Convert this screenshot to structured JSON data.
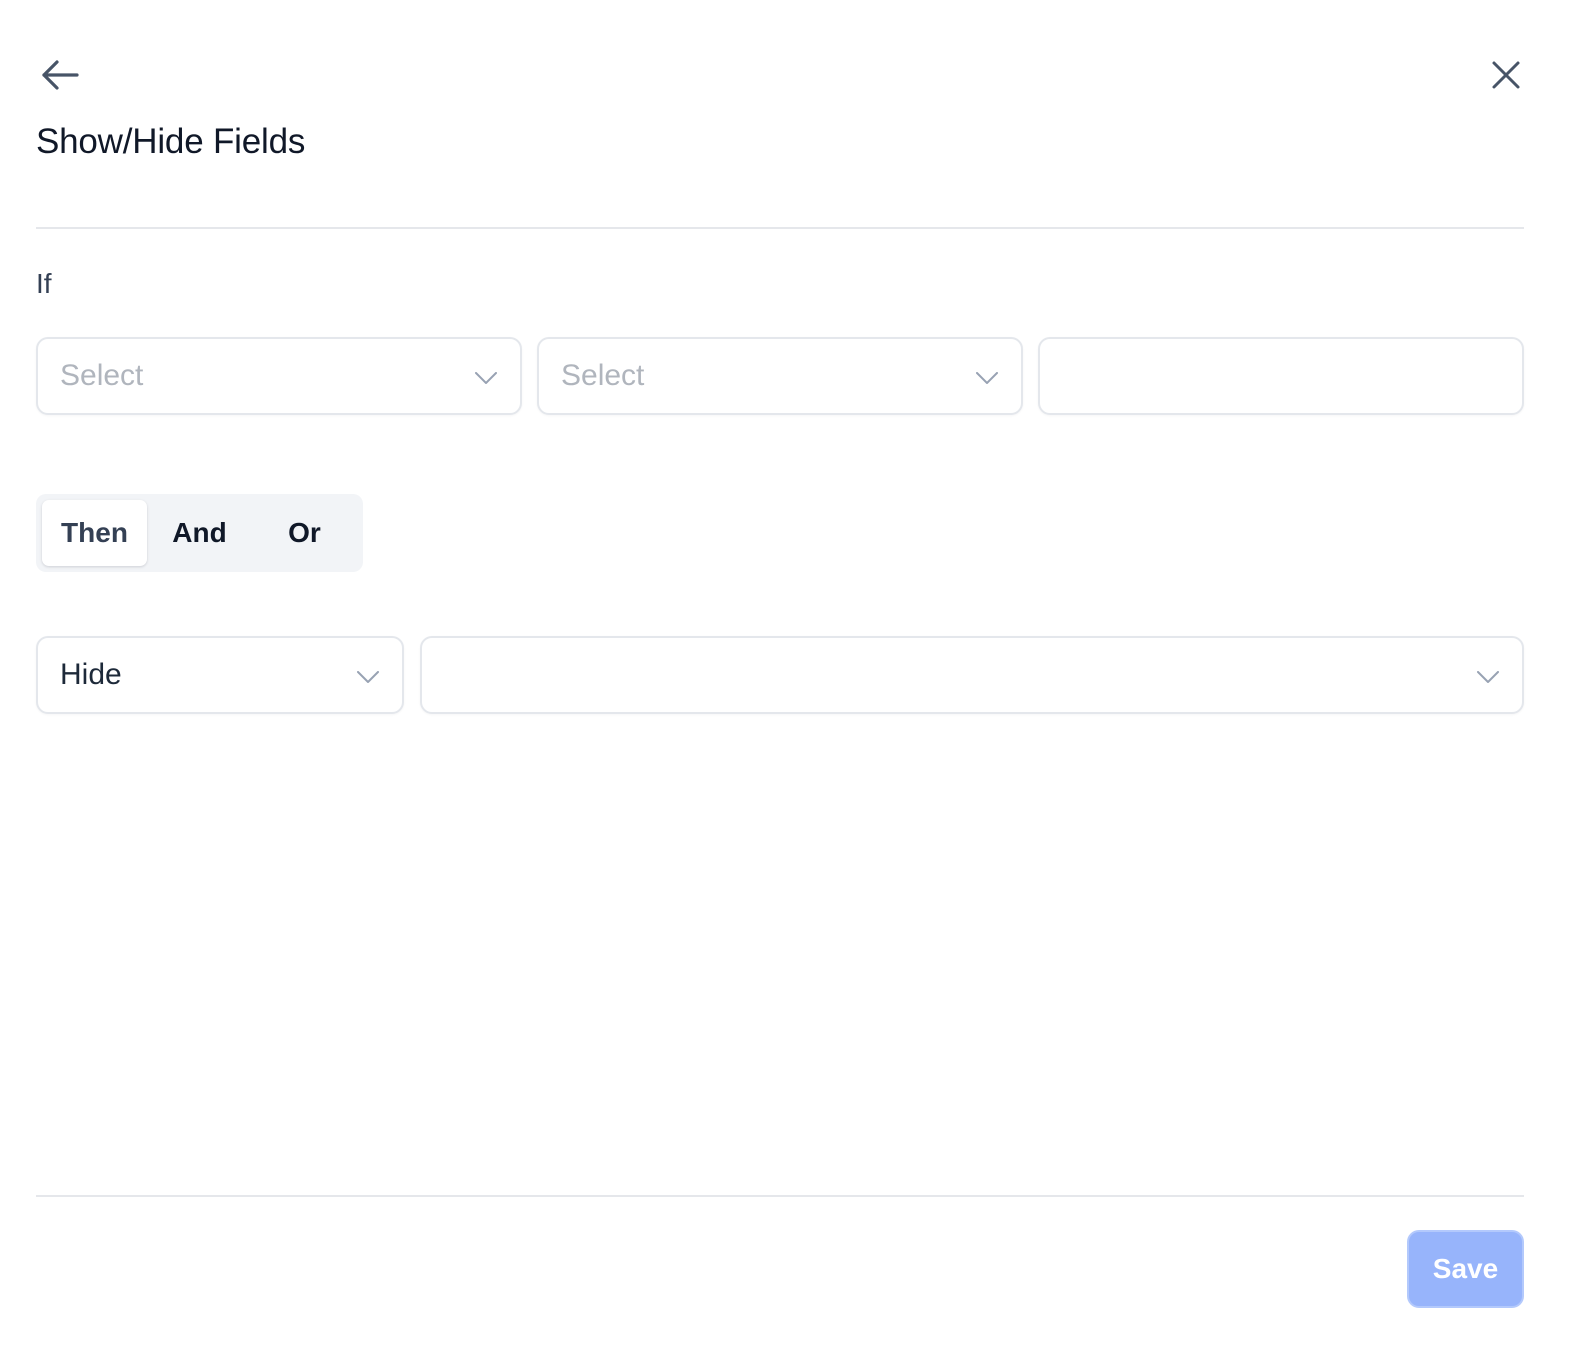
{
  "header": {
    "back_icon": "arrow-left-icon",
    "close_icon": "close-icon",
    "title": "Show/Hide Fields"
  },
  "condition": {
    "label": "If",
    "field_select": {
      "value": "",
      "placeholder": "Select"
    },
    "operator_select": {
      "value": "",
      "placeholder": "Select"
    },
    "value_input": {
      "value": "",
      "placeholder": ""
    }
  },
  "logic_tabs": [
    {
      "label": "Then",
      "active": true
    },
    {
      "label": "And",
      "active": false
    },
    {
      "label": "Or",
      "active": false
    }
  ],
  "action": {
    "action_select": {
      "value": "Hide"
    },
    "target_select": {
      "value": ""
    }
  },
  "footer": {
    "save_label": "Save"
  },
  "colors": {
    "primary_disabled": "#97b4fb",
    "border": "#e4e7ec",
    "text": "#101828",
    "placeholder": "#b0b5bd"
  }
}
